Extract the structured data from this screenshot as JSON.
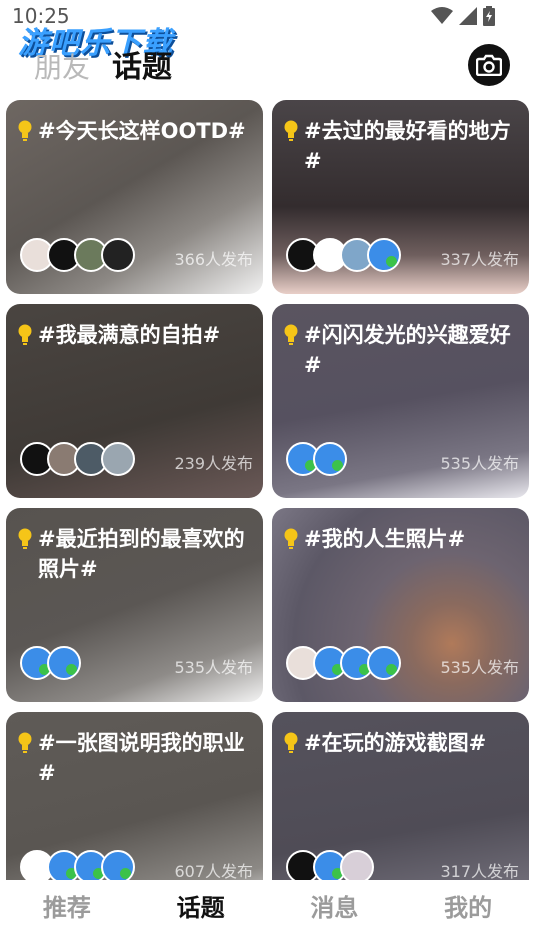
{
  "status_bar": {
    "time": "10:25"
  },
  "watermark": {
    "text": "游吧乐下载"
  },
  "header": {
    "tab_friends": "朋友",
    "tab_topics": "话题",
    "camera_icon": "camera-icon"
  },
  "topics": [
    {
      "title": "#今天长这样OOTD#",
      "count": "366人发布"
    },
    {
      "title": "#去过的最好看的地方#",
      "count": "337人发布"
    },
    {
      "title": "#我最满意的自拍#",
      "count": "239人发布"
    },
    {
      "title": "#闪闪发光的兴趣爱好#",
      "count": "535人发布"
    },
    {
      "title": "#最近拍到的最喜欢的照片#",
      "count": "535人发布"
    },
    {
      "title": "#我的人生照片#",
      "count": "535人发布"
    },
    {
      "title": "#一张图说明我的职业#",
      "count": "607人发布"
    },
    {
      "title": "#在玩的游戏截图#",
      "count": "317人发布"
    }
  ],
  "bottom_nav": {
    "recommend": "推荐",
    "topics": "话题",
    "messages": "消息",
    "mine": "我的"
  },
  "colors": {
    "accent_bulb": "#f5c518",
    "avatar_blue": "#3b8de8",
    "avatar_green": "#3cc24a"
  }
}
